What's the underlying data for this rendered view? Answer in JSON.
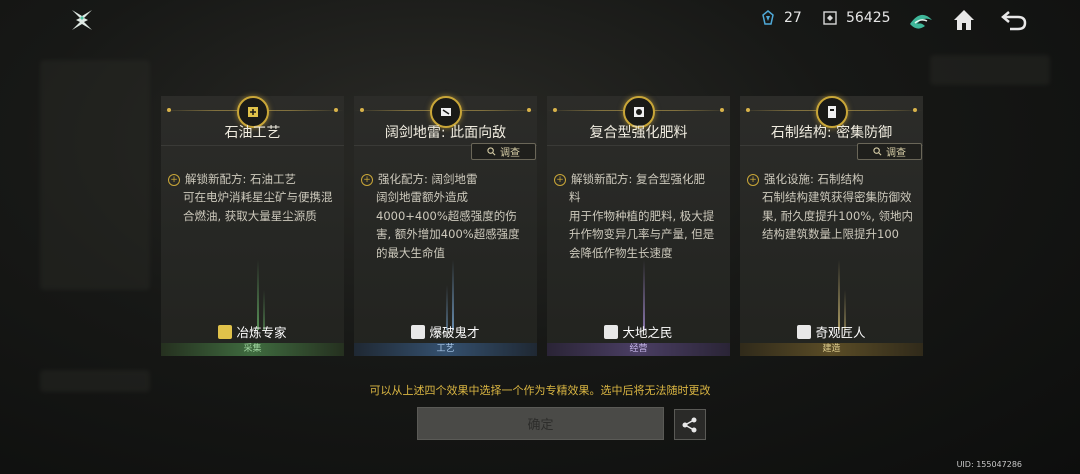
{
  "topbar": {
    "crystal_count": "27",
    "currency_count": "56425",
    "icons": [
      "game-logo-icon",
      "crystal-icon",
      "currency-icon",
      "rune-icon",
      "home-icon",
      "back-icon"
    ]
  },
  "cards": [
    {
      "title": "石油工艺",
      "has_inspect": false,
      "inspect_label": "",
      "desc_first": "解锁新配方: 石油工艺",
      "desc_rest": "可在电炉消耗星尘矿与便携混合燃油, 获取大量星尘源质",
      "role": "冶炼专家",
      "category": "采集",
      "accent": "#3f6b3f",
      "glow": "#6fbf6f"
    },
    {
      "title": "阔剑地雷: 此面向敌",
      "has_inspect": true,
      "inspect_label": "调查",
      "desc_first": "强化配方: 阔剑地雷",
      "desc_rest": "阔剑地雷额外造成4000+400%超感强度的伤害, 额外增加400%超感强度的最大生命值",
      "role": "爆破鬼才",
      "category": "工艺",
      "accent": "#34506e",
      "glow": "#7fb0e0"
    },
    {
      "title": "复合型强化肥料",
      "has_inspect": false,
      "inspect_label": "",
      "desc_first": "解锁新配方: 复合型强化肥",
      "desc_rest": "料\n用于作物种植的肥料, 极大提升作物变异几率与产量, 但是会降低作物生长速度",
      "role": "大地之民",
      "category": "经营",
      "accent": "#4a3e63",
      "glow": "#a98fd8"
    },
    {
      "title": "石制结构: 密集防御",
      "has_inspect": true,
      "inspect_label": "调查",
      "desc_first": "强化设施: 石制结构",
      "desc_rest": "石制结构建筑获得密集防御效果, 耐久度提升100%, 领地内结构建筑数量上限提升100",
      "role": "奇观匠人",
      "category": "建造",
      "accent": "#5a4c26",
      "glow": "#d8c27a"
    }
  ],
  "note": "可以从上述四个效果中选择一个作为专精效果。选中后将无法随时更改",
  "confirm_label": "确定",
  "uid": "UID: 155047286",
  "colors": {
    "gold": "#d9b542",
    "button_disabled": "#4a4a47"
  }
}
